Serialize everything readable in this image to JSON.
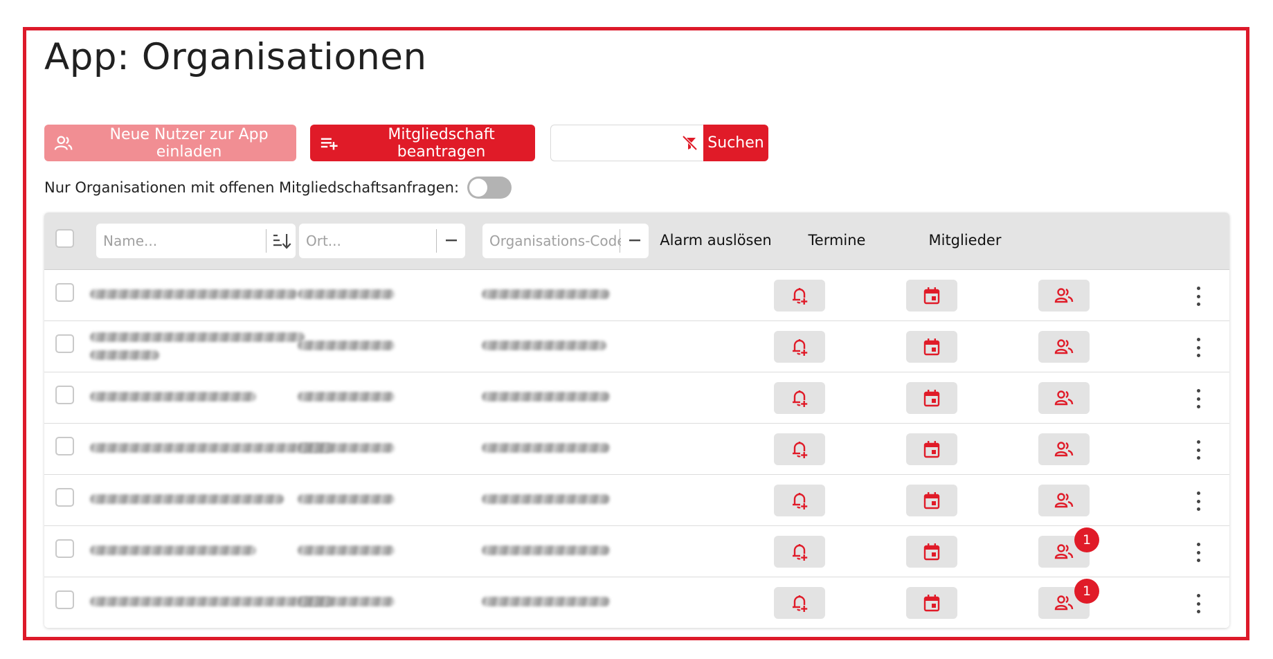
{
  "page": {
    "title": "App: Organisationen"
  },
  "toolbar": {
    "invite_label": "Neue Nutzer zur App einladen",
    "apply_label": "Mitgliedschaft beantragen",
    "search_value": "",
    "search_button_label": "Suchen"
  },
  "filter_toggle": {
    "label": "Nur Organisationen mit offenen Mitgliedschaftsanfragen:",
    "on": false
  },
  "table": {
    "columns": {
      "name_placeholder": "Name...",
      "ort_placeholder": "Ort...",
      "code_placeholder": "Organisations-Code.",
      "alarm": "Alarm auslösen",
      "termine": "Termine",
      "mitglieder": "Mitglieder"
    },
    "rows": [
      {
        "name": "",
        "ort": "",
        "code": "",
        "badge": ""
      },
      {
        "name": "",
        "ort": "",
        "code": "",
        "badge": ""
      },
      {
        "name": "",
        "ort": "",
        "code": "",
        "badge": ""
      },
      {
        "name": "",
        "ort": "",
        "code": "",
        "badge": ""
      },
      {
        "name": "",
        "ort": "",
        "code": "",
        "badge": ""
      },
      {
        "name": "",
        "ort": "",
        "code": "",
        "badge": "1"
      },
      {
        "name": "",
        "ort": "",
        "code": "",
        "badge": "1"
      }
    ]
  },
  "icons": {
    "invite": "group-add-icon",
    "apply": "playlist-add-icon",
    "filter_clear": "filter-off-icon",
    "sort": "sort-icon",
    "alarm": "bell-plus-icon",
    "termine": "calendar-icon",
    "mitglieder": "group-icon",
    "more": "more-vertical-icon"
  },
  "colors": {
    "accent": "#e01b28",
    "accent_light": "#f18e93",
    "frame": "#dd1a2a"
  }
}
